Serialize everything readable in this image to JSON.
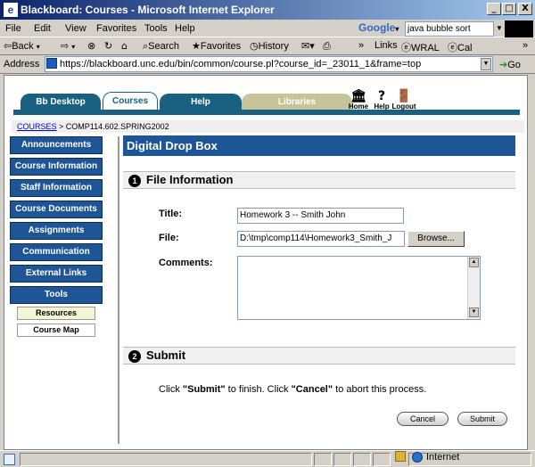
{
  "window": {
    "title": "Blackboard: Courses - Microsoft Internet Explorer",
    "min_label": "_",
    "max_label": "□",
    "close_label": "X"
  },
  "menu": {
    "items": [
      "File",
      "Edit",
      "View",
      "Favorites",
      "Tools",
      "Help"
    ]
  },
  "google": {
    "brand": "Google",
    "query": "java bubble sort"
  },
  "toolbar": {
    "back": "Back",
    "search": "Search",
    "favorites": "Favorites",
    "history": "History",
    "links": "Links",
    "wral": "WRAL",
    "cal": "Cal"
  },
  "address": {
    "label": "Address",
    "url": "https://blackboard.unc.edu/bin/common/course.pl?course_id=_23011_1&frame=top",
    "go": "Go"
  },
  "bb": {
    "tabs": [
      "Bb Desktop",
      "Courses",
      "Help",
      "Libraries"
    ],
    "icons": {
      "home": "Home",
      "help": "Help",
      "logout": "Logout"
    },
    "breadcrumb": {
      "root": "COURSES",
      "path": "> COMP114.602.SPRING2002"
    },
    "nav": [
      "Announcements",
      "Course Information",
      "Staff Information",
      "Course Documents",
      "Assignments",
      "Communication",
      "External Links",
      "Tools"
    ],
    "subnav": [
      "Resources",
      "Course Map"
    ],
    "page_title": "Digital Drop Box",
    "section1": {
      "num": "1",
      "title": "File Information"
    },
    "form": {
      "title_label": "Title:",
      "title_value": "Homework 3 -- Smith John",
      "file_label": "File:",
      "file_value": "D:\\tmp\\comp114\\Homework3_Smith_J",
      "browse": "Browse...",
      "comments_label": "Comments:"
    },
    "section2": {
      "num": "2",
      "title": "Submit"
    },
    "instructions": {
      "pre": "Click ",
      "submit_word": "\"Submit\"",
      "mid": " to finish. Click ",
      "cancel_word": "\"Cancel\"",
      "post": " to abort this process."
    },
    "buttons": {
      "cancel": "Cancel",
      "submit": "Submit"
    }
  },
  "status": {
    "zone": "Internet"
  },
  "colors": {
    "nav_blue": "#1e5596",
    "tab_teal": "#1a6080",
    "libraries_tan": "#c8c49a"
  }
}
